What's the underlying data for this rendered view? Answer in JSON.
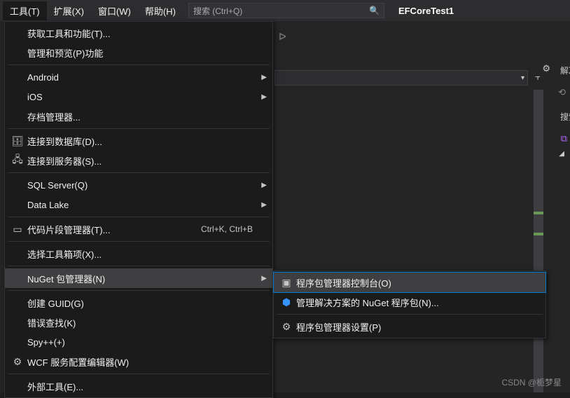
{
  "menubar": {
    "tools": "工具(T)",
    "extensions": "扩展(X)",
    "window": "窗口(W)",
    "help": "帮助(H)"
  },
  "search": {
    "placeholder": "搜索 (Ctrl+Q)"
  },
  "project": {
    "name": "EFCoreTest1"
  },
  "rightPanel": {
    "solution": "解决",
    "searchLabel": "搜索"
  },
  "menu": {
    "getTools": "获取工具和功能(T)...",
    "managePreview": "管理和预览(P)功能",
    "android": "Android",
    "ios": "iOS",
    "archiveManager": "存档管理器...",
    "connectDb": "连接到数据库(D)...",
    "connectServer": "连接到服务器(S)...",
    "sqlServer": "SQL Server(Q)",
    "dataLake": "Data Lake",
    "snippetMgr": "代码片段管理器(T)...",
    "snippetShortcut": "Ctrl+K, Ctrl+B",
    "chooseToolbox": "选择工具箱项(X)...",
    "nuget": "NuGet 包管理器(N)",
    "createGuid": "创建 GUID(G)",
    "errorLookup": "错误查找(K)",
    "spy": "Spy++(+)",
    "wcf": "WCF 服务配置编辑器(W)",
    "externalTools": "外部工具(E)..."
  },
  "submenu": {
    "console": "程序包管理器控制台(O)",
    "manageSolution": "管理解决方案的 NuGet 程序包(N)...",
    "settings": "程序包管理器设置(P)"
  },
  "watermark": "CSDN @栀梦星"
}
